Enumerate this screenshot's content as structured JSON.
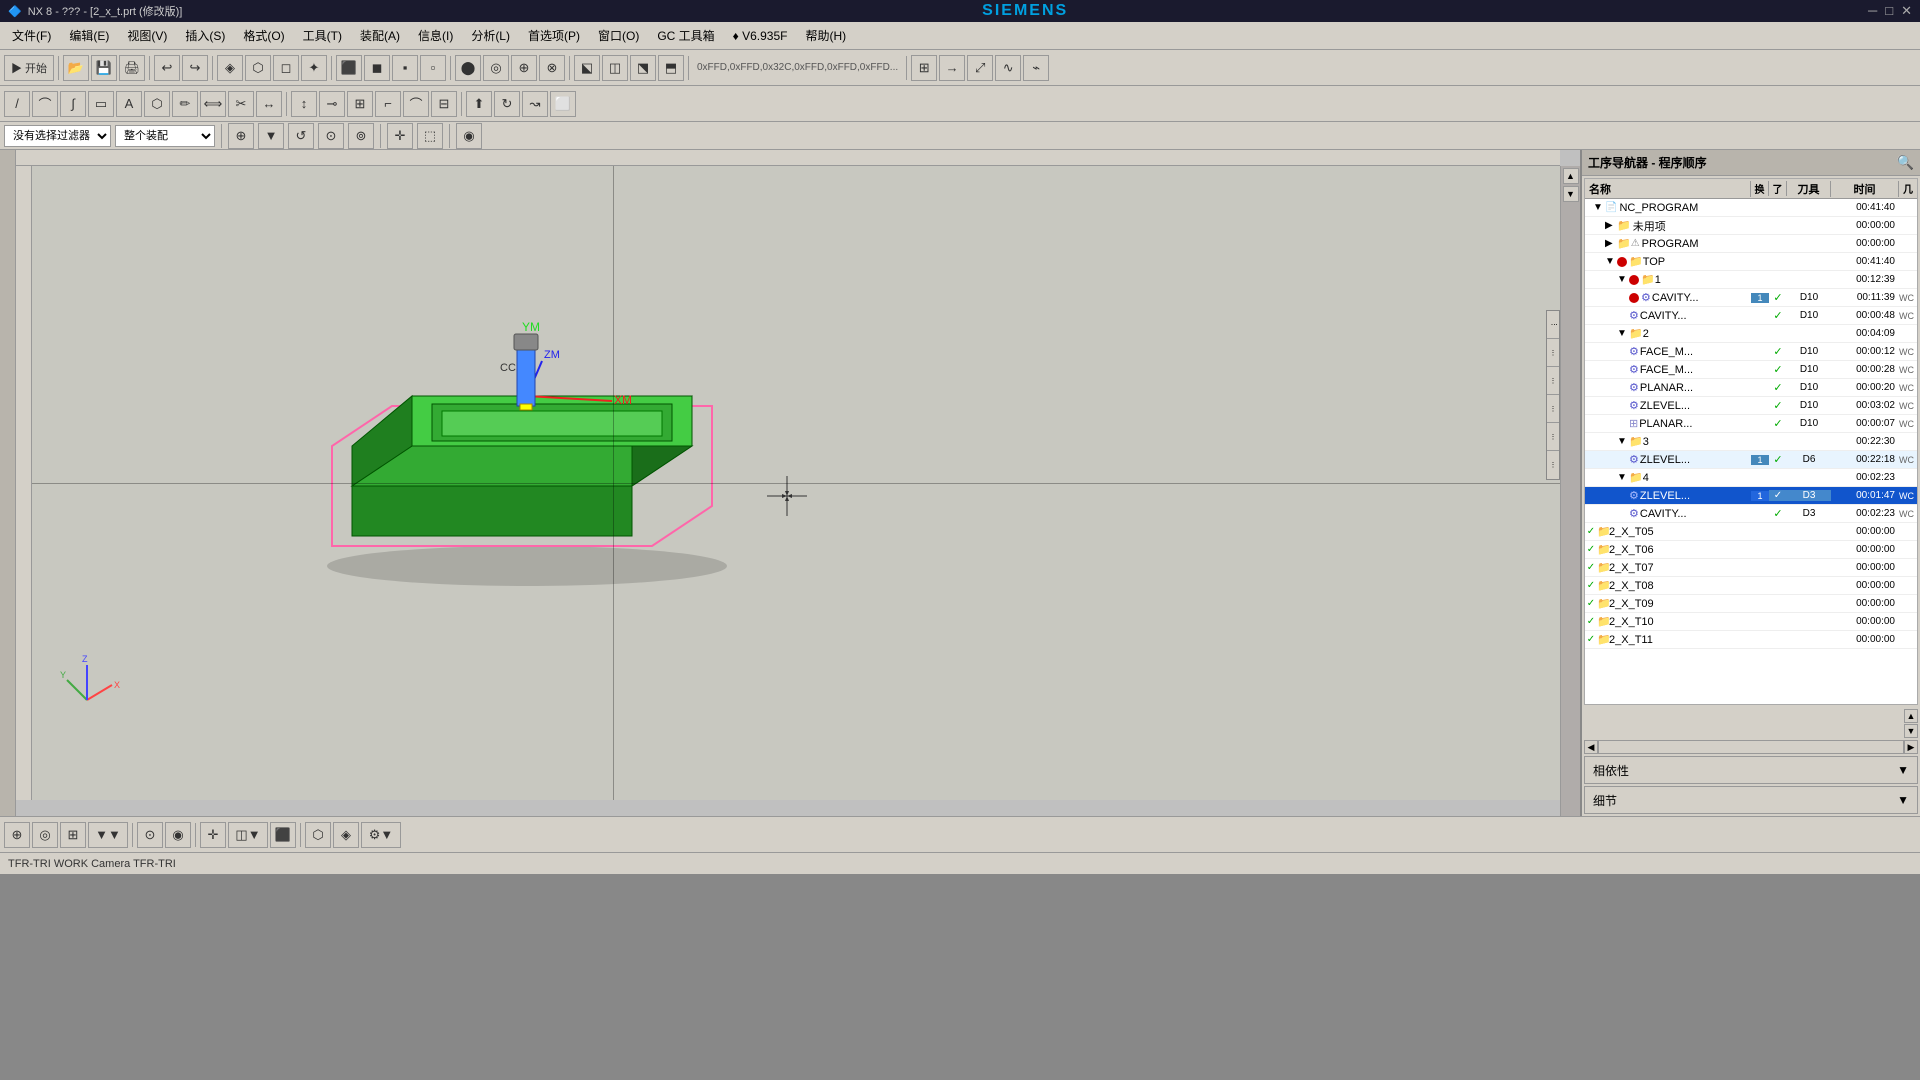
{
  "titlebar": {
    "title": "NX 8 - ??? - [2_x_t.prt (修改版)]",
    "brand": "SIEMENS",
    "minimize": "─",
    "restore": "□",
    "close": "✕"
  },
  "menubar": {
    "items": [
      "文件(F)",
      "编辑(E)",
      "视图(V)",
      "插入(S)",
      "格式(O)",
      "工具(T)",
      "装配(A)",
      "信息(I)",
      "分析(L)",
      "首选项(P)",
      "窗口(O)",
      "GC 工具箱",
      "♦ V6.935F",
      "帮助(H)"
    ]
  },
  "toolbar3": {
    "filter_placeholder": "没有选择过滤器",
    "scope": "整个装配"
  },
  "right_panel": {
    "title": "工序导航器 - 程序顺序",
    "columns": [
      "名称",
      "换",
      "了",
      "刀具",
      "时间",
      "几"
    ],
    "tree": [
      {
        "id": "NC_PROGRAM",
        "label": "NC_PROGRAM",
        "level": 0,
        "time": "00:41:40",
        "type": "root",
        "expanded": true
      },
      {
        "id": "UNUSED",
        "label": "未用项",
        "level": 1,
        "time": "00:00:00",
        "type": "folder",
        "expanded": false
      },
      {
        "id": "PROGRAM",
        "label": "PROGRAM",
        "level": 1,
        "time": "00:00:00",
        "type": "folder",
        "expanded": false
      },
      {
        "id": "TOP",
        "label": "TOP",
        "level": 1,
        "time": "00:41:40",
        "type": "folder-op",
        "expanded": true,
        "has_error": true
      },
      {
        "id": "1",
        "label": "1",
        "level": 2,
        "time": "00:12:39",
        "type": "folder",
        "expanded": true
      },
      {
        "id": "CAVITY1",
        "label": "CAVITY...",
        "level": 3,
        "time": "00:11:39",
        "type": "op",
        "tool": "D10",
        "has_num": true,
        "wc": "WC",
        "check": true
      },
      {
        "id": "CAVITY2",
        "label": "CAVITY...",
        "level": 3,
        "time": "00:00:48",
        "type": "op",
        "tool": "D10",
        "wc": "WC",
        "check": true
      },
      {
        "id": "2",
        "label": "2",
        "level": 2,
        "time": "00:04:09",
        "type": "folder",
        "expanded": true
      },
      {
        "id": "FACE_M1",
        "label": "FACE_M...",
        "level": 3,
        "time": "00:00:12",
        "type": "op",
        "tool": "D10",
        "wc": "WC",
        "check": true
      },
      {
        "id": "FACE_M2",
        "label": "FACE_M...",
        "level": 3,
        "time": "00:00:28",
        "type": "op",
        "tool": "D10",
        "wc": "WC",
        "check": true
      },
      {
        "id": "PLANAR1",
        "label": "PLANAR...",
        "level": 3,
        "time": "00:00:20",
        "type": "op",
        "tool": "D10",
        "wc": "WC",
        "check": true
      },
      {
        "id": "ZLEVEL1",
        "label": "ZLEVEL...",
        "level": 3,
        "time": "00:03:02",
        "type": "op",
        "tool": "D10",
        "wc": "WC",
        "check": true
      },
      {
        "id": "PLANAR2",
        "label": "PLANAR...",
        "level": 3,
        "time": "00:00:07",
        "type": "op",
        "tool": "D10",
        "wc": "WC",
        "check": true
      },
      {
        "id": "3",
        "label": "3",
        "level": 2,
        "time": "00:22:30",
        "type": "folder",
        "expanded": true
      },
      {
        "id": "ZLEVEL2",
        "label": "ZLEVEL...",
        "level": 3,
        "time": "00:22:18",
        "type": "op",
        "tool": "D6",
        "has_num": true,
        "wc": "WC",
        "check": true
      },
      {
        "id": "4",
        "label": "4",
        "level": 2,
        "time": "00:02:23",
        "type": "folder",
        "expanded": true
      },
      {
        "id": "ZLEVEL3",
        "label": "ZLEVEL...",
        "level": 3,
        "time": "00:01:47",
        "type": "op",
        "tool": "D3",
        "has_num": true,
        "wc": "WC",
        "check": true,
        "selected": true
      },
      {
        "id": "CAVITY3",
        "label": "CAVITY...",
        "level": 3,
        "time": "00:02:23",
        "type": "op",
        "tool": "D3",
        "wc": "WC",
        "check": true
      },
      {
        "id": "2_X_T05",
        "label": "2_X_T05",
        "level": 1,
        "time": "00:00:00",
        "type": "folder2",
        "check": true
      },
      {
        "id": "2_X_T06",
        "label": "2_X_T06",
        "level": 1,
        "time": "00:00:00",
        "type": "folder2",
        "check": true
      },
      {
        "id": "2_X_T07",
        "label": "2_X_T07",
        "level": 1,
        "time": "00:00:00",
        "type": "folder2",
        "check": true
      },
      {
        "id": "2_X_T08",
        "label": "2_X_T08",
        "level": 1,
        "time": "00:00:00",
        "type": "folder2",
        "check": true
      },
      {
        "id": "2_X_T09",
        "label": "2_X_T09",
        "level": 1,
        "time": "00:00:00",
        "type": "folder2",
        "check": true
      },
      {
        "id": "2_X_T10",
        "label": "2_X_T10",
        "level": 1,
        "time": "00:00:00",
        "type": "folder2",
        "check": true
      },
      {
        "id": "2_X_T11",
        "label": "2_X_T11",
        "level": 1,
        "time": "00:00:00",
        "type": "folder2",
        "check": true
      }
    ]
  },
  "bottom_panels": [
    {
      "label": "相依性",
      "expanded": false
    },
    {
      "label": "细节",
      "expanded": false
    }
  ],
  "status_bar": {
    "text": "TFR-TRI  WORK  Camera  TFR-TRI"
  },
  "viewport": {
    "label": "3D viewport"
  }
}
